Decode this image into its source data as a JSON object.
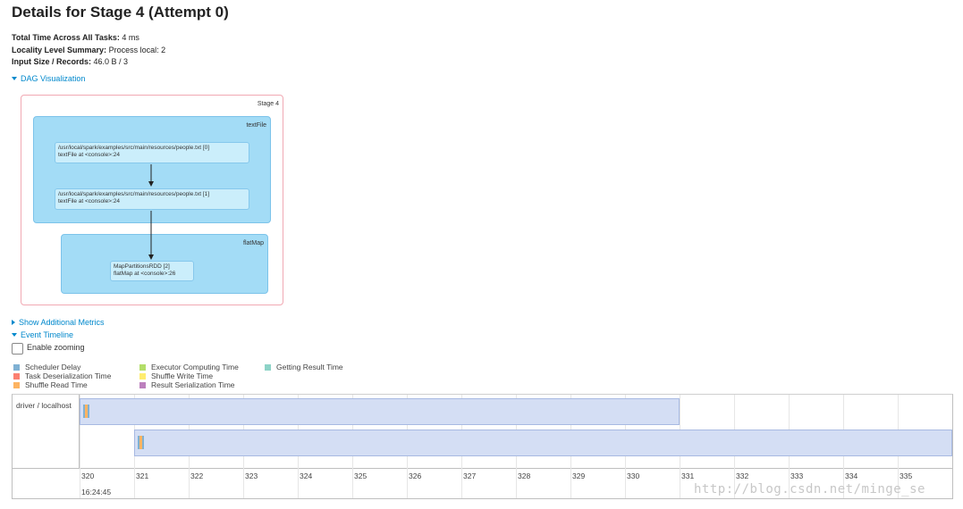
{
  "page": {
    "title": "Details for Stage 4 (Attempt 0)"
  },
  "summary": {
    "total_time_label": "Total Time Across All Tasks:",
    "total_time_value": "4 ms",
    "locality_label": "Locality Level Summary:",
    "locality_value": "Process local: 2",
    "input_label": "Input Size / Records:",
    "input_value": "46.0 B / 3"
  },
  "links": {
    "dag": "DAG Visualization",
    "additional_metrics": "Show Additional Metrics",
    "event_timeline": "Event Timeline"
  },
  "dag": {
    "stage_label": "Stage 4",
    "clusters": [
      {
        "label": "textFile",
        "nodes": [
          {
            "line1": "/usr/local/spark/examples/src/main/resources/people.txt [0]",
            "line2": "textFile at <console>:24"
          },
          {
            "line1": "/usr/local/spark/examples/src/main/resources/people.txt [1]",
            "line2": "textFile at <console>:24"
          }
        ]
      },
      {
        "label": "flatMap",
        "nodes": [
          {
            "line1": "MapPartitionsRDD [2]",
            "line2": "flatMap at <console>:26"
          }
        ]
      }
    ],
    "colors": {
      "cluster": "#a3dcf6",
      "node": "#cbeefb",
      "stage_border": "#f1a9b3"
    }
  },
  "zoom": {
    "label": "Enable zooming",
    "checked": false
  },
  "legend": [
    {
      "label": "Scheduler Delay",
      "color": "#80b1d3"
    },
    {
      "label": "Task Deserialization Time",
      "color": "#fb8072"
    },
    {
      "label": "Shuffle Read Time",
      "color": "#fdb462"
    },
    {
      "label": "Executor Computing Time",
      "color": "#b3de69"
    },
    {
      "label": "Shuffle Write Time",
      "color": "#ffed6f"
    },
    {
      "label": "Result Serialization Time",
      "color": "#bc80bd"
    },
    {
      "label": "Getting Result Time",
      "color": "#8dd3c7"
    }
  ],
  "timeline": {
    "executor_label": "driver / localhost",
    "ticks": [
      "320",
      "321",
      "322",
      "323",
      "324",
      "325",
      "326",
      "327",
      "328",
      "329",
      "330",
      "331",
      "332",
      "333",
      "334",
      "335"
    ],
    "date_label": "16:24:45",
    "tasks": [
      {
        "start": 320.0,
        "end": 331.0
      },
      {
        "start": 321.0,
        "end": 336.0
      }
    ],
    "task_color": "#d4def4"
  },
  "watermark": "http://blog.csdn.net/minge_se"
}
